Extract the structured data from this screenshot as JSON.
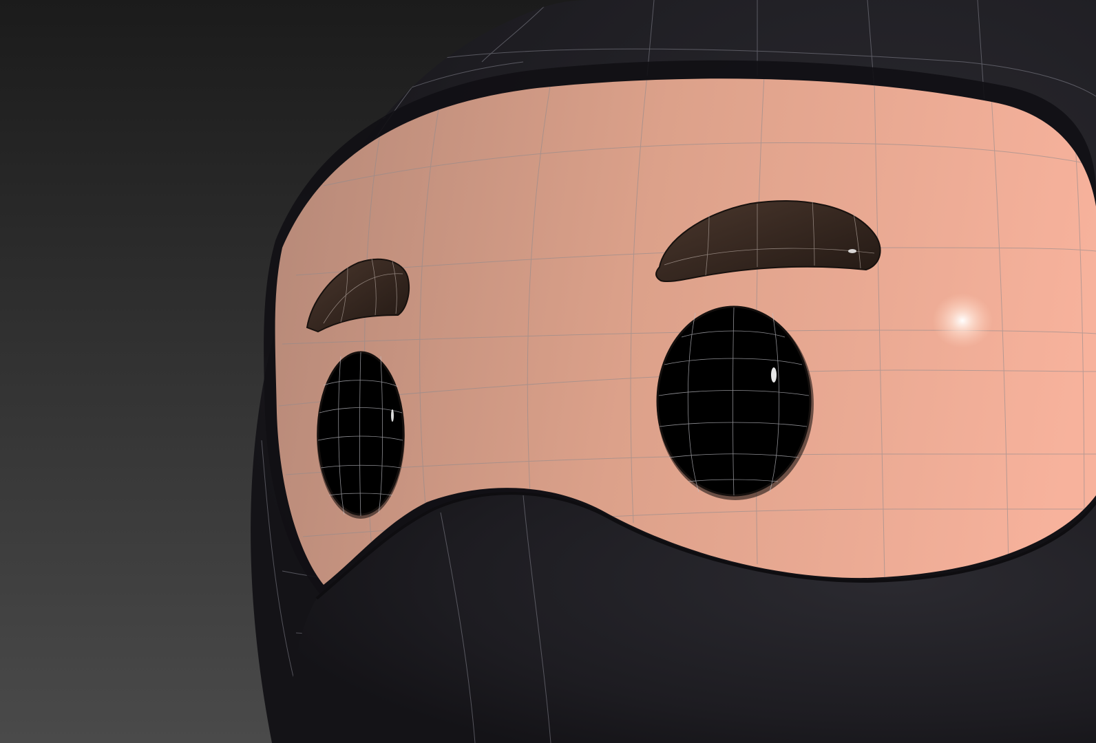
{
  "viewport": {
    "background_top": "#1b1b1b",
    "background_bottom": "#4a4a4a"
  },
  "model": {
    "mask_color": "#1e1d22",
    "skin_light": "#f7b29c",
    "skin_dark": "#b88a79",
    "eye_color": "#000000",
    "brow_color": "#3a2b24",
    "wire_color": "#c9c9d2",
    "highlight_color": "#ffffff"
  }
}
